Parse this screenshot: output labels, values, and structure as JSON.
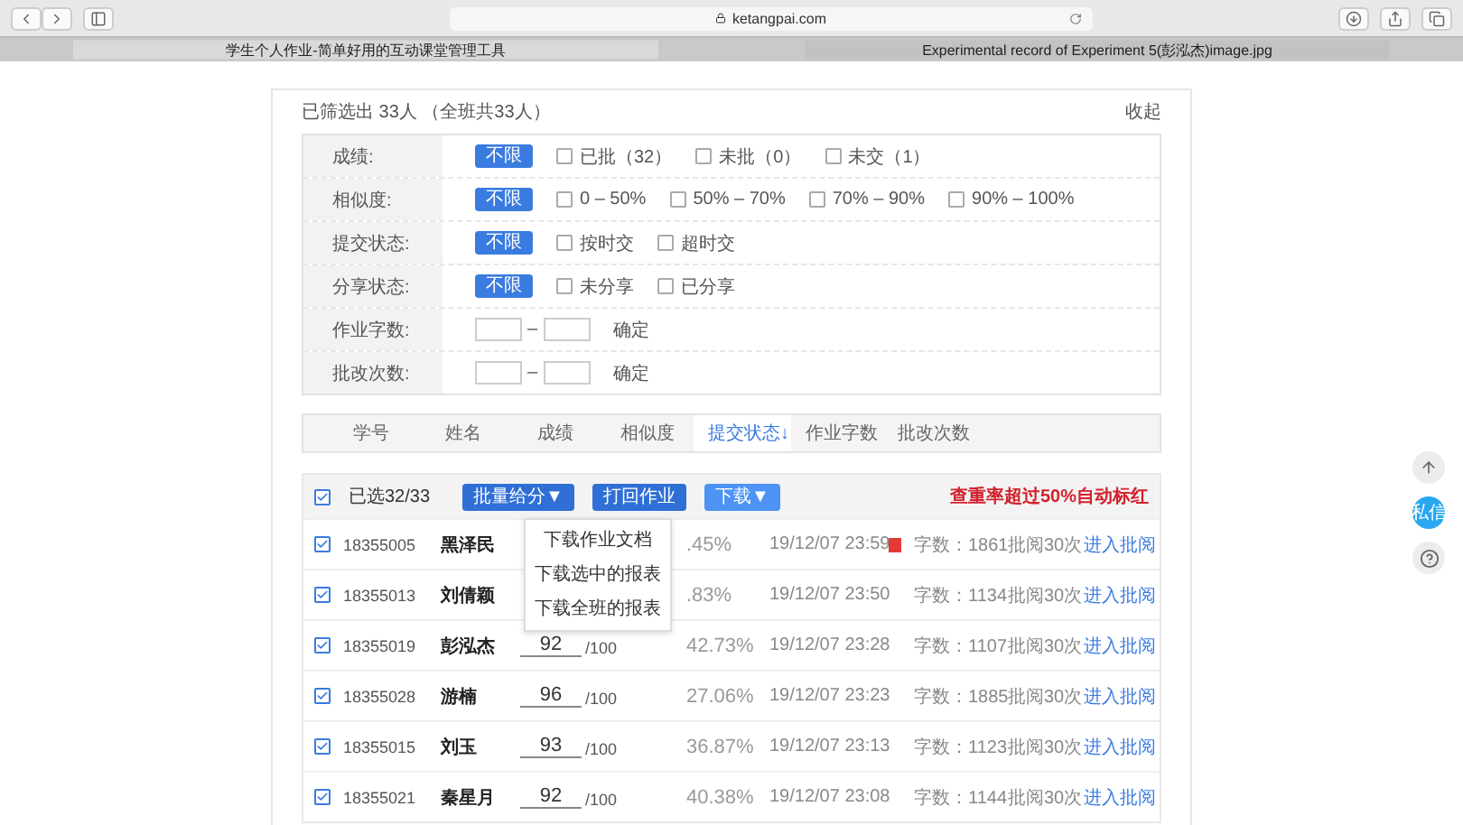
{
  "browser": {
    "url": "ketangpai.com"
  },
  "tabs": [
    {
      "title": "学生个人作业-简单好用的互动课堂管理工具",
      "selected": true
    },
    {
      "title": "Experimental record of Experiment 5(彭泓杰)image.jpg",
      "selected": false
    }
  ],
  "summary": "已筛选出 33人 （全班共33人）",
  "collapse": "收起",
  "filters": [
    {
      "label": "成绩:",
      "kind": "options",
      "options": [
        {
          "label": "不限",
          "selected": true
        },
        {
          "label": "已批（32）",
          "selected": false
        },
        {
          "label": "未批（0）",
          "selected": false
        },
        {
          "label": "未交（1）",
          "selected": false
        }
      ]
    },
    {
      "label": "相似度:",
      "kind": "options",
      "options": [
        {
          "label": "不限",
          "selected": true
        },
        {
          "label": "0 – 50%",
          "selected": false
        },
        {
          "label": "50% – 70%",
          "selected": false
        },
        {
          "label": "70% – 90%",
          "selected": false
        },
        {
          "label": "90% – 100%",
          "selected": false
        }
      ]
    },
    {
      "label": "提交状态:",
      "kind": "options",
      "options": [
        {
          "label": "不限",
          "selected": true
        },
        {
          "label": "按时交",
          "selected": false
        },
        {
          "label": "超时交",
          "selected": false
        }
      ]
    },
    {
      "label": "分享状态:",
      "kind": "options",
      "options": [
        {
          "label": "不限",
          "selected": true
        },
        {
          "label": "未分享",
          "selected": false
        },
        {
          "label": "已分享",
          "selected": false
        }
      ]
    },
    {
      "label": "作业字数:",
      "kind": "range",
      "separator": "–",
      "confirm": "确定"
    },
    {
      "label": "批改次数:",
      "kind": "range",
      "separator": "–",
      "confirm": "确定"
    }
  ],
  "sort_columns": [
    {
      "label": "学号",
      "selected": false
    },
    {
      "label": "姓名",
      "selected": false
    },
    {
      "label": "成绩",
      "selected": false
    },
    {
      "label": "相似度",
      "selected": false
    },
    {
      "label": "提交状态↓",
      "selected": true
    },
    {
      "label": "作业字数",
      "selected": false
    },
    {
      "label": "批改次数",
      "selected": false
    }
  ],
  "toolbar": {
    "checked": true,
    "count": "已选32/33",
    "buttons": [
      {
        "label": "批量给分▼",
        "active": false
      },
      {
        "label": "打回作业",
        "active": false
      },
      {
        "label": "下载▼",
        "active": true
      }
    ],
    "notice": "查重率超过50%自动标红"
  },
  "dropdown": [
    "下载作业文档",
    "下载选中的报表",
    "下载全班的报表"
  ],
  "rows": [
    {
      "checked": true,
      "id": "18355005",
      "name": "黑泽民",
      "similarity": ".45%",
      "time": "19/12/07 23:59",
      "flagged": true,
      "words": "字数：1861",
      "reviews": "批阅30次",
      "action": "进入批阅"
    },
    {
      "checked": true,
      "id": "18355013",
      "name": "刘倩颖",
      "similarity": ".83%",
      "time": "19/12/07 23:50",
      "flagged": false,
      "words": "字数：1134",
      "reviews": "批阅30次",
      "action": "进入批阅"
    },
    {
      "checked": true,
      "id": "18355019",
      "name": "彭泓杰",
      "score": "92",
      "total": "/100",
      "similarity": "42.73%",
      "time": "19/12/07 23:28",
      "flagged": false,
      "words": "字数：1107",
      "reviews": "批阅30次",
      "action": "进入批阅"
    },
    {
      "checked": true,
      "id": "18355028",
      "name": "游楠",
      "score": "96",
      "total": "/100",
      "similarity": "27.06%",
      "time": "19/12/07 23:23",
      "flagged": false,
      "words": "字数：1885",
      "reviews": "批阅30次",
      "action": "进入批阅"
    },
    {
      "checked": true,
      "id": "18355015",
      "name": "刘玉",
      "score": "93",
      "total": "/100",
      "similarity": "36.87%",
      "time": "19/12/07 23:13",
      "flagged": false,
      "words": "字数：1123",
      "reviews": "批阅30次",
      "action": "进入批阅"
    },
    {
      "checked": true,
      "id": "18355021",
      "name": "秦星月",
      "score": "92",
      "total": "/100",
      "similarity": "40.38%",
      "time": "19/12/07 23:08",
      "flagged": false,
      "words": "字数：1144",
      "reviews": "批阅30次",
      "action": "进入批阅"
    }
  ],
  "side_buttons": [
    {
      "kind": "up"
    },
    {
      "kind": "message",
      "label": "私信"
    },
    {
      "kind": "help"
    }
  ]
}
